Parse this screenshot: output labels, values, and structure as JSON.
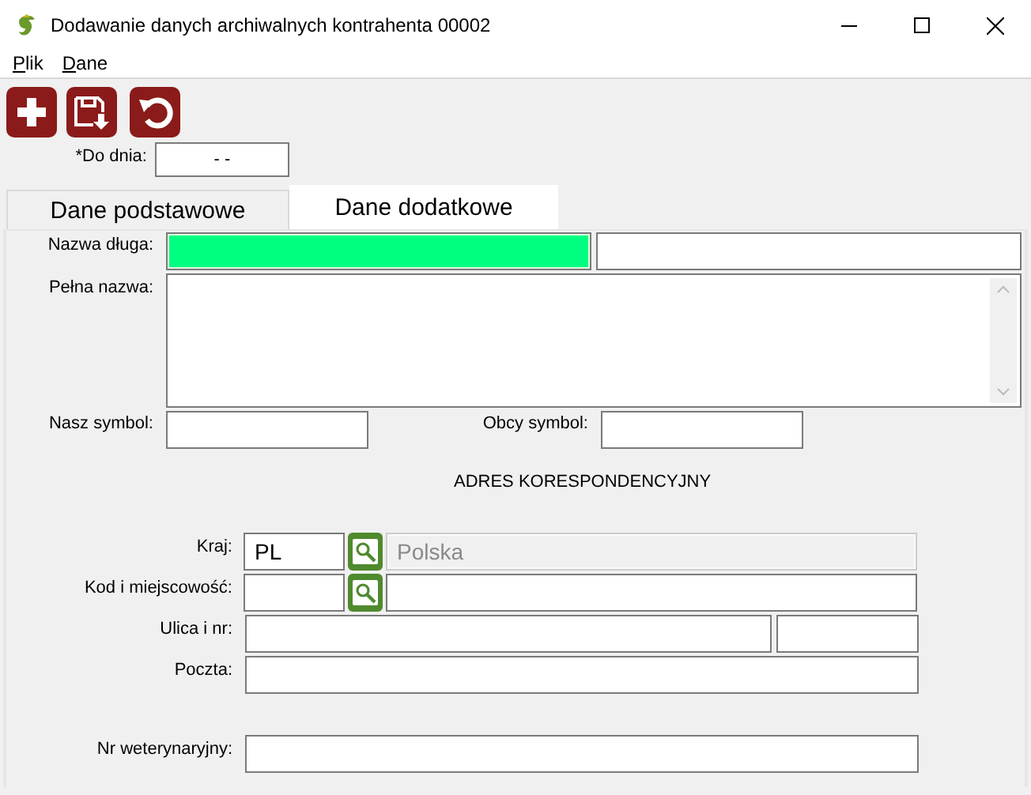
{
  "window": {
    "title": "Dodawanie danych archiwalnych kontrahenta 00002"
  },
  "menu": [
    {
      "label": "Plik"
    },
    {
      "label": "Dane"
    }
  ],
  "toolbar": [
    {
      "kind": "add"
    },
    {
      "kind": "save"
    },
    {
      "kind": "undo"
    }
  ],
  "date_field": {
    "label": "*Do dnia:",
    "value": "-  -"
  },
  "tabs": [
    {
      "label": "Dane podstawowe",
      "selected": false
    },
    {
      "label": "Dane dodatkowe",
      "selected": true
    }
  ],
  "name_fields": [
    {
      "label": "Nazwa długa:",
      "kind": "double",
      "highlighted": true
    },
    {
      "label": "Pełna nazwa:",
      "kind": "textarea",
      "highlighted": false
    }
  ],
  "symbols": [
    {
      "label": "Nasz symbol:"
    },
    {
      "label": "Obcy symbol:"
    }
  ],
  "section_title": "ADRES KORESPONDENCYJNY",
  "address": [
    {
      "label": "Kraj:",
      "kind": "lookup",
      "code": "PL",
      "name": "Polska",
      "name_disabled": true
    },
    {
      "label": "Kod i miejscowość:",
      "kind": "lookup",
      "name_disabled": false
    },
    {
      "label": "Ulica i nr:",
      "kind": "split"
    },
    {
      "label": "Poczta:",
      "kind": "single"
    }
  ],
  "vet_number": {
    "label": "Nr weterynaryjny:"
  }
}
